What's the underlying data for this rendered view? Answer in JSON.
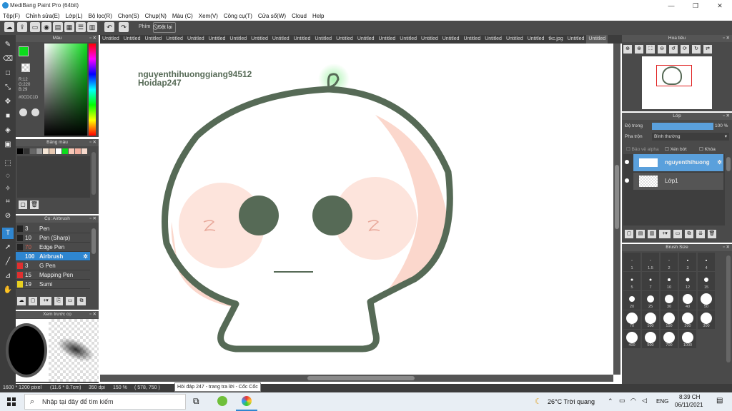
{
  "window": {
    "title": "MediBang Paint Pro (64bit)",
    "minimize": "—",
    "maximize": "❐",
    "close": "✕"
  },
  "menu": [
    "Tệp(F)",
    "Chỉnh sửa(E)",
    "Lớp(L)",
    "Bộ lọc(R)",
    "Chọn(S)",
    "Chụp(N)",
    "Màu (C)",
    "Xem(V)",
    "Công cụ(T)",
    "Cửa sổ(W)",
    "Cloud",
    "Help"
  ],
  "toolbar": {
    "key_label": "Phím",
    "reset_label": "Đặt lại"
  },
  "tabs": [
    "Untitled",
    "Untitled",
    "Untitled",
    "Untitled",
    "Untitled",
    "Untitled",
    "Untitled",
    "Untitled",
    "Untitled",
    "Untitled",
    "Untitled",
    "Untitled",
    "Untitled",
    "Untitled",
    "Untitled",
    "Untitled",
    "Untitled",
    "Untitled",
    "Untitled",
    "Untitled",
    "Untitled",
    "tkc.jpg",
    "Untitled",
    "Untitled"
  ],
  "color_panel": {
    "title": "Màu",
    "r": "R:12",
    "g": "G:220",
    "b": "B:29",
    "hex": "#0CDC1D",
    "fg_color": "#0cdc1d"
  },
  "palette": {
    "title": "Bảng màu",
    "colors": [
      "#000000",
      "#333333",
      "#666666",
      "#999999",
      "#f5e6d6",
      "#e7c9b2",
      "#ffffff",
      "#0cdc1d",
      "#f8c8b8",
      "#f3b0a0",
      "#f6d9cc"
    ]
  },
  "brushes": {
    "title": "Cọ: Airbrush",
    "items": [
      {
        "size": "3",
        "name": "Pen",
        "color": "#222222",
        "num_color": "#eeeeee"
      },
      {
        "size": "10",
        "name": "Pen (Sharp)",
        "color": "#222222",
        "num_color": "#eeeeee"
      },
      {
        "size": "70",
        "name": "Edge Pen",
        "color": "#222222",
        "num_color": "#d06050"
      },
      {
        "size": "100",
        "name": "Airbrush",
        "color": "#2f86d0",
        "num_color": "#ffffff",
        "active": true
      },
      {
        "size": "3",
        "name": "G Pen",
        "color": "#e03030",
        "num_color": "#eeeeee"
      },
      {
        "size": "15",
        "name": "Mapping Pen",
        "color": "#e03030",
        "num_color": "#eeeeee"
      },
      {
        "size": "19",
        "name": "Sumi",
        "color": "#e8d020",
        "num_color": "#eeeeee"
      }
    ]
  },
  "preview": {
    "title": "Xem trước cọ"
  },
  "navigator": {
    "title": "Hoa tiêu"
  },
  "layers": {
    "title": "Lớp",
    "opacity_label": "Độ trong",
    "opacity_value": "100 %",
    "opacity": 1.0,
    "blend_label": "Pha trộn",
    "blend_value": "Bình thường",
    "protect_alpha": "Bảo vệ alpha",
    "clip": "Xén bớt",
    "lock": "Khóa",
    "items": [
      {
        "name": "nguyenthihuong",
        "active": true
      },
      {
        "name": "Lớp1",
        "active": false
      }
    ]
  },
  "brush_size": {
    "title": "Brush Size",
    "sizes": [
      "1",
      "1.5",
      "2",
      "3",
      "4",
      "5",
      "7",
      "10",
      "12",
      "15",
      "20",
      "25",
      "30",
      "40",
      "50",
      "70",
      "100",
      "150",
      "200",
      "300",
      "400",
      "500",
      "700",
      "1000"
    ]
  },
  "canvas": {
    "watermark_line1": "nguyenthihuonggiang94512",
    "watermark_line2": "Hoidap247"
  },
  "status": {
    "size": "1600 * 1200 pixel",
    "physical": "(11.6 * 8.7cm)",
    "dpi": "350 dpi",
    "zoom": "150 %",
    "coords": "( 578, 750 )"
  },
  "tooltip": "Hỏi đáp 247 - trang tra lời - Cốc Cốc",
  "taskbar": {
    "search_placeholder": "Nhập tại đây để tìm kiếm",
    "weather": "26°C  Trời quang",
    "lang": "ENG",
    "time": "8:39 CH",
    "date": "06/11/2021"
  }
}
